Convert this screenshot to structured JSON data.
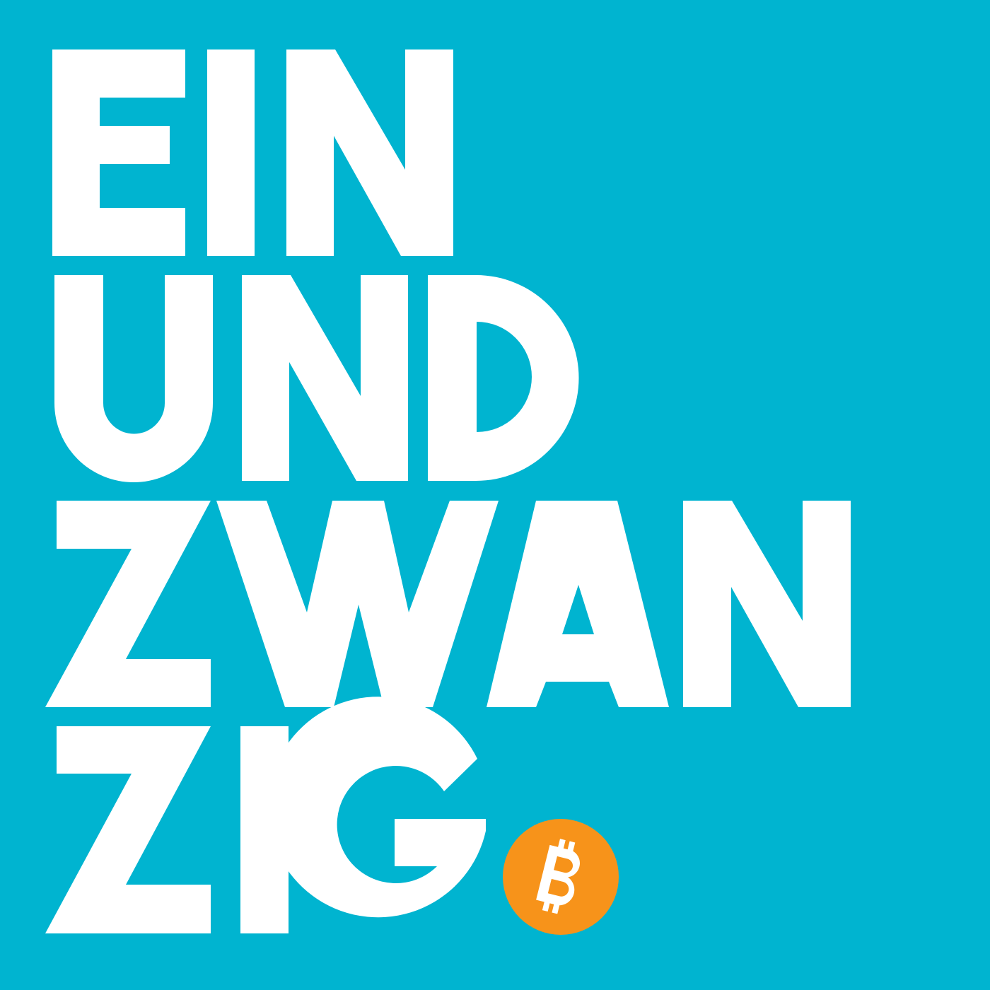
{
  "logo": {
    "lines": [
      "EIN",
      "UND",
      "ZWAN",
      "ZIG"
    ],
    "badge_symbol": "bitcoin-icon"
  },
  "colors": {
    "background": "#00B4D0",
    "letters": "#FFFFFF",
    "badge": "#F7931A",
    "badge_symbol": "#FFFFFF"
  }
}
